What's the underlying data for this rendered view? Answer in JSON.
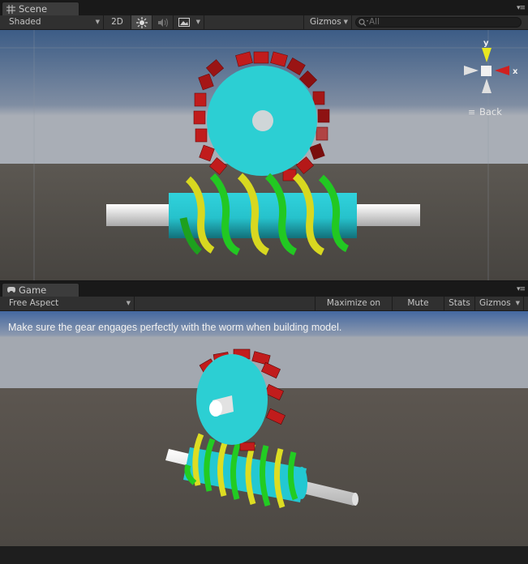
{
  "scene": {
    "tab_label": "Scene",
    "shading_mode": "Shaded",
    "toggle_2d": "2D",
    "gizmos_label": "Gizmos",
    "search_placeholder": "All",
    "gizmo_axes": {
      "y": "y",
      "x": "x"
    },
    "gizmo_back_label": "Back"
  },
  "game": {
    "tab_label": "Game",
    "aspect": "Free Aspect",
    "maximize_label": "Maximize on Play",
    "mute_label": "Mute audio",
    "stats_label": "Stats",
    "gizmos_label": "Gizmos",
    "overlay_text": "Make sure the gear engages perfectly with the worm when building model."
  },
  "colors": {
    "gear_face": "#2ccfd3",
    "gear_teeth": "#c11c1c",
    "worm_shaft": "#23c8d2",
    "worm_thread_green": "#22cc22",
    "worm_thread_yellow": "#dddd22",
    "axle": "#e8e8e8"
  },
  "icons": [
    "scene-tab-icon",
    "game-tab-icon",
    "sun-icon",
    "audio-icon",
    "image-icon",
    "search-icon",
    "menu-icon"
  ]
}
